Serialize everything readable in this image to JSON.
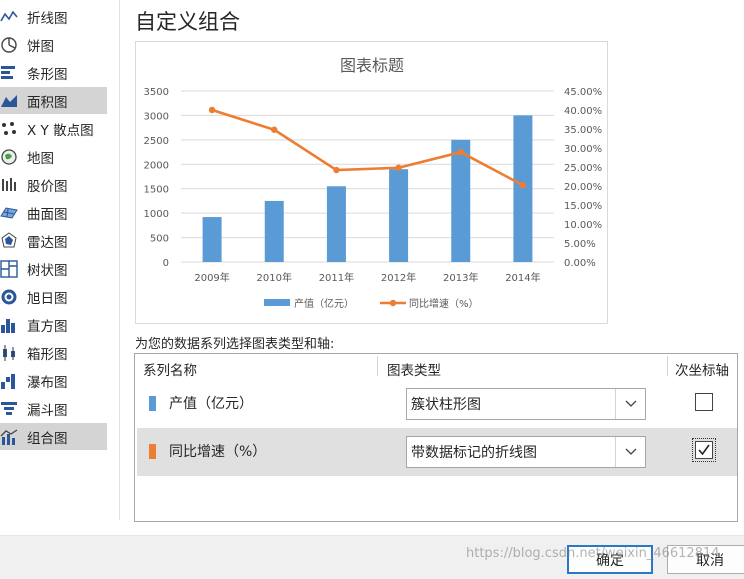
{
  "sidebar": {
    "items": [
      {
        "label": "折线图",
        "icon": "line-chart-icon"
      },
      {
        "label": "饼图",
        "icon": "pie-chart-icon"
      },
      {
        "label": "条形图",
        "icon": "bar-chart-icon"
      },
      {
        "label": "面积图",
        "icon": "area-chart-icon"
      },
      {
        "label": "X Y 散点图",
        "icon": "scatter-chart-icon"
      },
      {
        "label": "地图",
        "icon": "map-chart-icon"
      },
      {
        "label": "股价图",
        "icon": "stock-chart-icon"
      },
      {
        "label": "曲面图",
        "icon": "surface-chart-icon"
      },
      {
        "label": "雷达图",
        "icon": "radar-chart-icon"
      },
      {
        "label": "树状图",
        "icon": "treemap-chart-icon"
      },
      {
        "label": "旭日图",
        "icon": "sunburst-chart-icon"
      },
      {
        "label": "直方图",
        "icon": "histogram-chart-icon"
      },
      {
        "label": "箱形图",
        "icon": "boxplot-chart-icon"
      },
      {
        "label": "瀑布图",
        "icon": "waterfall-chart-icon"
      },
      {
        "label": "漏斗图",
        "icon": "funnel-chart-icon"
      },
      {
        "label": "组合图",
        "icon": "combo-chart-icon"
      }
    ],
    "selected_index": 15,
    "hover_index": 3
  },
  "dialog": {
    "title": "自定义组合",
    "section_label": "为您的数据系列选择图表类型和轴:",
    "columns": {
      "series_name": "系列名称",
      "chart_type": "图表类型",
      "secondary_axis": "次坐标轴"
    },
    "rows": [
      {
        "name": "产值（亿元）",
        "type": "簇状柱形图",
        "secondary": false,
        "color": "#5b9bd5"
      },
      {
        "name": "同比增速（%）",
        "type": "带数据标记的折线图",
        "secondary": true,
        "color": "#ed7d31"
      }
    ],
    "ok_label": "确定",
    "cancel_label": "取消",
    "watermark": "https://blog.csdn.net/weixin_46612814"
  },
  "chart_data": {
    "type": "bar",
    "title": "图表标题",
    "categories": [
      "2009年",
      "2010年",
      "2011年",
      "2012年",
      "2013年",
      "2014年"
    ],
    "series": [
      {
        "name": "产值（亿元）",
        "kind": "bar",
        "axis": "primary",
        "color": "#5b9bd5",
        "values": [
          920,
          1250,
          1550,
          1900,
          2500,
          3000
        ]
      },
      {
        "name": "同比增速（%）",
        "kind": "line",
        "axis": "secondary",
        "color": "#ed7d31",
        "values": [
          40.0,
          34.8,
          24.2,
          24.8,
          28.9,
          20.2
        ]
      }
    ],
    "ylim": [
      0,
      3500
    ],
    "y_ticks": [
      "0",
      "500",
      "1000",
      "1500",
      "2000",
      "2500",
      "3000",
      "3500"
    ],
    "y2lim": [
      0,
      45
    ],
    "y2_ticks": [
      "0.00%",
      "5.00%",
      "10.00%",
      "15.00%",
      "20.00%",
      "25.00%",
      "30.00%",
      "35.00%",
      "40.00%",
      "45.00%"
    ],
    "grid": true,
    "legend": "bottom"
  }
}
